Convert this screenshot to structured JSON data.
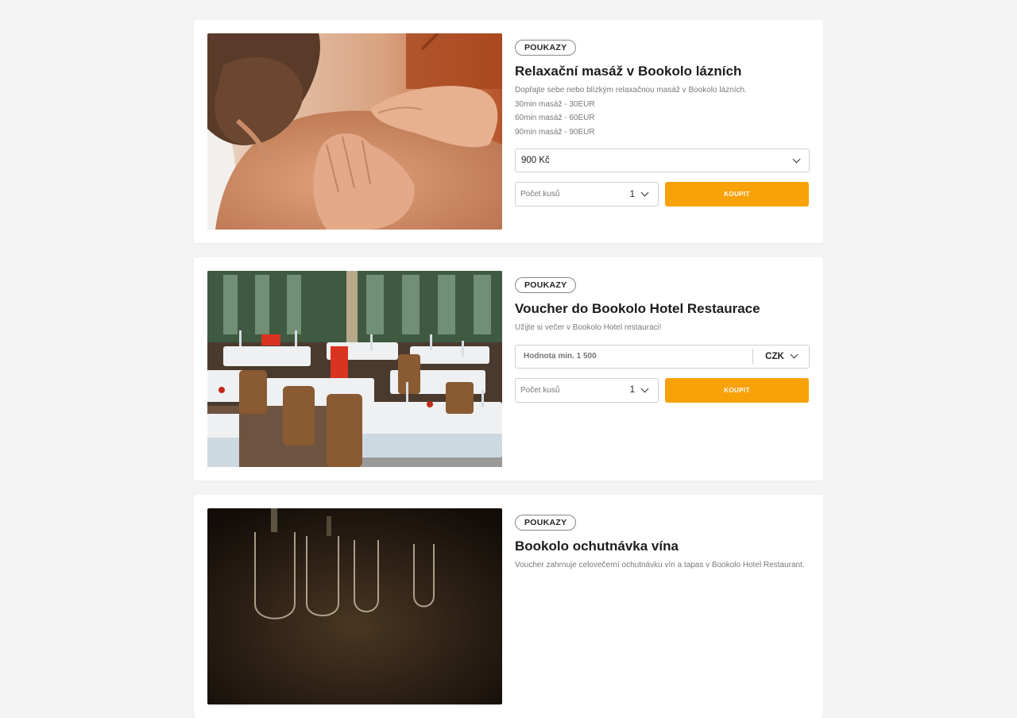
{
  "offers": [
    {
      "badge": "POUKAZY",
      "title": "Relaxační masáž v Bookolo lázních",
      "description": [
        "Dopřajte sebe nebo blízkým relaxačnou masáž v Bookolo lázních.",
        "30min masáž - 30EUR",
        "60min masáž - 60EUR",
        "90min masáž - 90EUR"
      ],
      "price_select": "900 Kč",
      "quantity_label": "Počet kusů",
      "quantity_value": "1",
      "buy_label": "KOUPIT",
      "image": "massage-photo"
    },
    {
      "badge": "POUKAZY",
      "title": "Voucher do Bookolo Hotel Restaurace",
      "description": [
        "Užijte si večer v Bookolo Hotel restauraci!"
      ],
      "value_placeholder": "Hodnota min. 1 500",
      "currency": "CZK",
      "quantity_label": "Počet kusů",
      "quantity_value": "1",
      "buy_label": "KOUPIT",
      "image": "restaurant-photo"
    },
    {
      "badge": "POUKAZY",
      "title": "Bookolo ochutnávka vína",
      "description": [
        "Voucher zahrnuje celovečerní ochutnávku vín a tapas v Bookolo Hotel Restaurant."
      ],
      "image": "wine-glasses-photo"
    }
  ],
  "colors": {
    "accent": "#f9a109",
    "background": "#f3f3f3",
    "card": "#ffffff"
  },
  "icons": {
    "dropdown": "chevron-down-icon"
  }
}
